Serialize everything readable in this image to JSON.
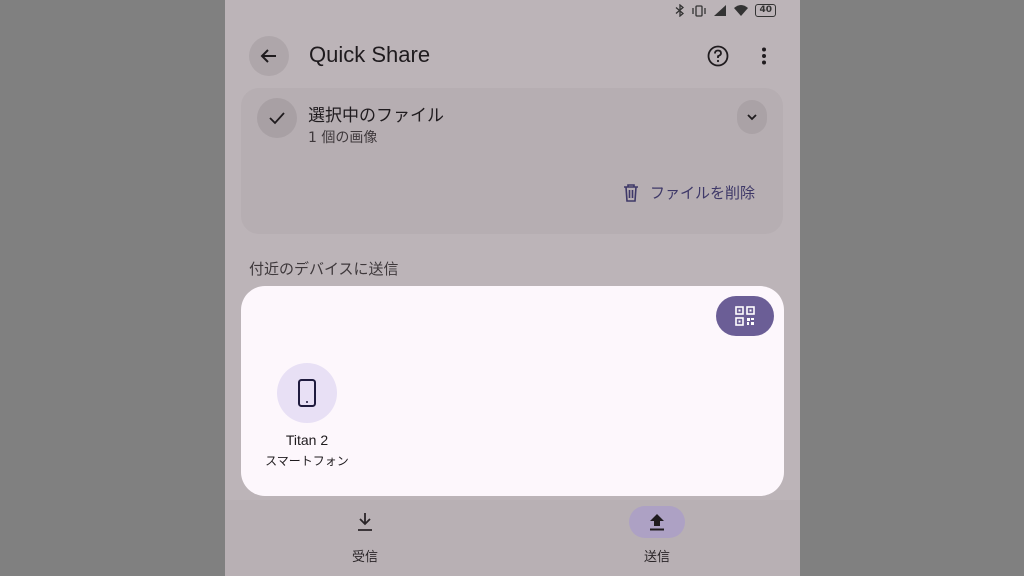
{
  "status_bar": {
    "battery": "40"
  },
  "app_bar": {
    "title": "Quick Share"
  },
  "selected_files": {
    "title": "選択中のファイル",
    "subtitle": "1 個の画像",
    "delete_label": "ファイルを削除"
  },
  "nearby": {
    "section_label": "付近のデバイスに送信",
    "devices": [
      {
        "name": "Titan 2",
        "type": "スマートフォン"
      }
    ]
  },
  "bottom_nav": {
    "items": [
      {
        "label": "受信",
        "icon": "download-icon",
        "selected": false
      },
      {
        "label": "送信",
        "icon": "upload-icon",
        "selected": true
      }
    ]
  },
  "colors": {
    "accent": "#6b5e96",
    "device_avatar": "#e8e0f5",
    "card": "#fdf7fc"
  }
}
